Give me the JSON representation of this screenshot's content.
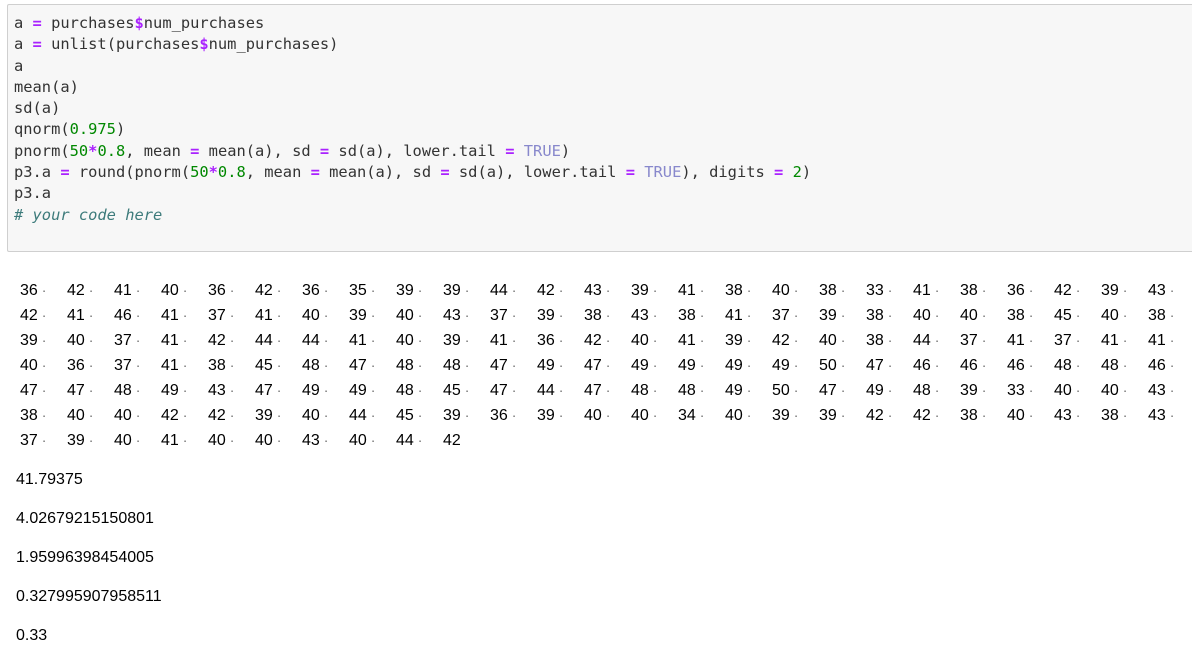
{
  "code_cell": {
    "lines": [
      "a = purchases$num_purchases",
      "a = unlist(purchases$num_purchases)",
      "a",
      "mean(a)",
      "sd(a)",
      "qnorm(0.975)",
      "pnorm(50*0.8, mean = mean(a), sd = sd(a), lower.tail = TRUE)",
      "p3.a = round(pnorm(50*0.8, mean = mean(a), sd = sd(a), lower.tail = TRUE), digits = 2)",
      "p3.a",
      "# your code here"
    ]
  },
  "output": {
    "vector_rows": [
      [
        "36",
        "42",
        "41",
        "40",
        "36",
        "42",
        "36",
        "35",
        "39",
        "39",
        "44",
        "42",
        "43",
        "39",
        "41",
        "38",
        "40",
        "38",
        "33",
        "41",
        "38",
        "36",
        "42",
        "39",
        "43"
      ],
      [
        "42",
        "41",
        "46",
        "41",
        "37",
        "41",
        "40",
        "39",
        "40",
        "43",
        "37",
        "39",
        "38",
        "43",
        "38",
        "41",
        "37",
        "39",
        "38",
        "40",
        "40",
        "38",
        "45",
        "40",
        "38"
      ],
      [
        "39",
        "40",
        "37",
        "41",
        "42",
        "44",
        "44",
        "41",
        "40",
        "39",
        "41",
        "36",
        "42",
        "40",
        "41",
        "39",
        "42",
        "40",
        "38",
        "44",
        "37",
        "41",
        "37",
        "41",
        "41"
      ],
      [
        "40",
        "36",
        "37",
        "41",
        "38",
        "45",
        "48",
        "47",
        "48",
        "48",
        "47",
        "49",
        "47",
        "49",
        "49",
        "49",
        "49",
        "50",
        "47",
        "46",
        "46",
        "46",
        "48",
        "48",
        "46"
      ],
      [
        "47",
        "47",
        "48",
        "49",
        "43",
        "47",
        "49",
        "49",
        "48",
        "45",
        "47",
        "44",
        "47",
        "48",
        "48",
        "49",
        "50",
        "47",
        "49",
        "48",
        "39",
        "33",
        "40",
        "40",
        "43"
      ],
      [
        "38",
        "40",
        "40",
        "42",
        "42",
        "39",
        "40",
        "44",
        "45",
        "39",
        "36",
        "39",
        "40",
        "40",
        "34",
        "40",
        "39",
        "39",
        "42",
        "42",
        "38",
        "40",
        "43",
        "38",
        "43"
      ],
      [
        "37",
        "39",
        "40",
        "41",
        "40",
        "40",
        "43",
        "40",
        "44",
        "42"
      ]
    ],
    "mean_value": "41.79375",
    "sd_value": "4.02679215150801",
    "qnorm_value": "1.95996398454005",
    "pnorm_value": "0.327995907958511",
    "p3a_value": "0.33"
  }
}
